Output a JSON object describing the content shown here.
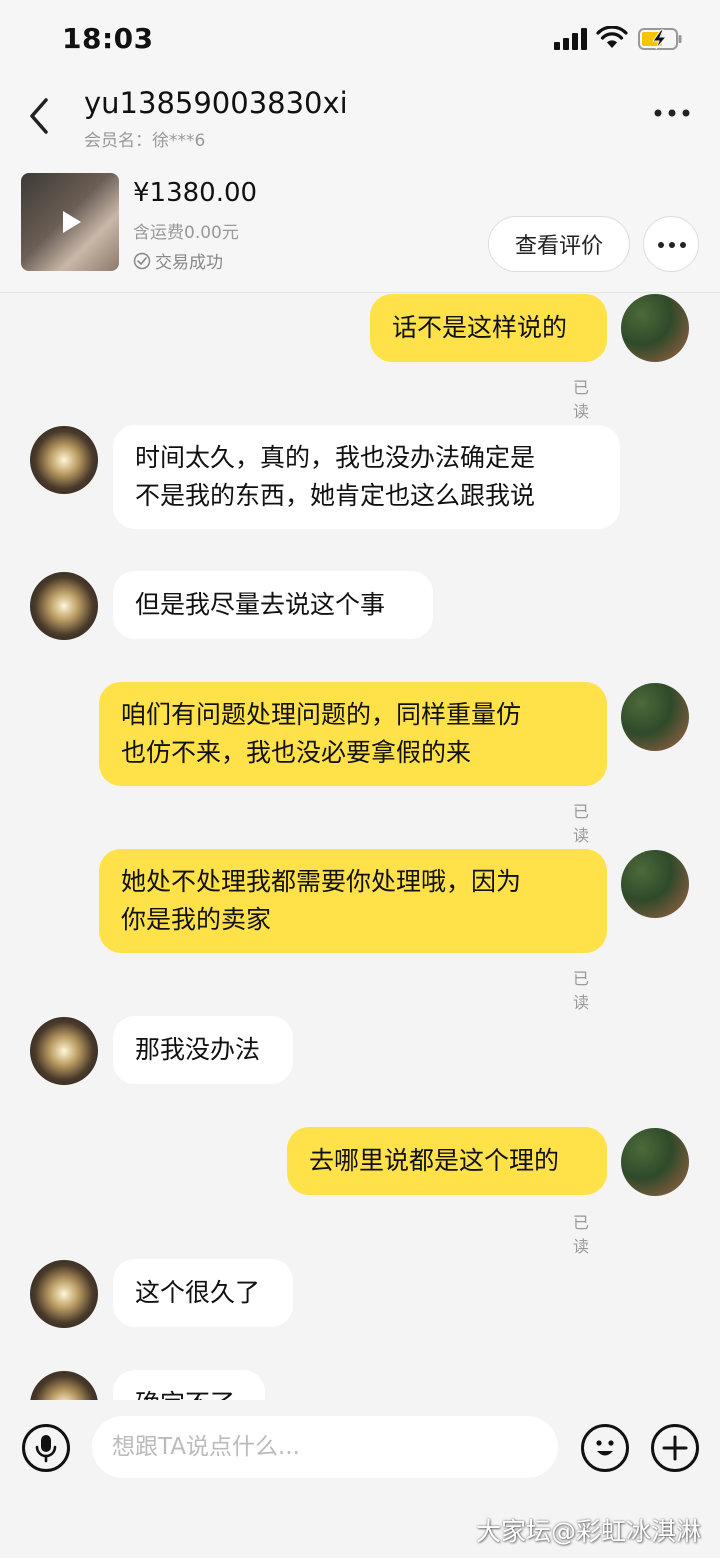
{
  "status_bar": {
    "time": "18:03"
  },
  "header": {
    "title": "yu13859003830xi",
    "subtitle": "会员名：徐***6"
  },
  "product": {
    "price": "¥1380.00",
    "shipping": "含运费0.00元",
    "status": "交易成功",
    "review_button": "查看评价"
  },
  "messages": [
    {
      "sender": "me",
      "text": "话不是这样说的",
      "read": "已读"
    },
    {
      "sender": "other",
      "text": "时间太久，真的，我也没办法确定是\n不是我的东西，她肯定也这么跟我说"
    },
    {
      "sender": "other",
      "text": "但是我尽量去说这个事"
    },
    {
      "sender": "me",
      "text": "咱们有问题处理问题的，同样重量仿\n也仿不来，我也没必要拿假的来",
      "read": "已读"
    },
    {
      "sender": "me",
      "text": "她处不处理我都需要你处理哦，因为\n你是我的卖家",
      "read": "已读"
    },
    {
      "sender": "other",
      "text": "那我没办法"
    },
    {
      "sender": "me",
      "text": "去哪里说都是这个理的",
      "read": "已读"
    },
    {
      "sender": "other",
      "text": "这个很久了"
    },
    {
      "sender": "other",
      "text": "确定不了"
    }
  ],
  "input": {
    "placeholder": "想跟TA说点什么..."
  },
  "watermark": "大家坛@彩虹冰淇淋",
  "colors": {
    "my_bubble": "#ffe14a",
    "other_bubble": "#ffffff",
    "background": "#f4f4f4"
  },
  "icons": [
    "back-arrow-icon",
    "more-icon",
    "play-icon",
    "check-circle-icon",
    "microphone-icon",
    "emoji-icon",
    "plus-icon"
  ]
}
